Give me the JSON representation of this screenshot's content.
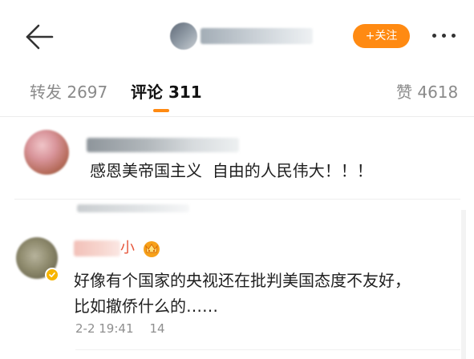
{
  "header": {
    "follow_label": "+关注"
  },
  "tabs": [
    {
      "label": "转发 2697",
      "active": false
    },
    {
      "label": "评论 311",
      "active": true
    },
    {
      "label": "赞 4618",
      "active": false
    }
  ],
  "comments": [
    {
      "text": "感恩美帝国主义  自由的人民伟大！！！"
    },
    {
      "name_visible": "小",
      "text_lines": [
        "好像有个国家的央视还在批判美国态度不友好，",
        "比如撤侨什么的……"
      ],
      "time": "2-2 19:41",
      "likes": "14"
    }
  ],
  "colors": {
    "accent": "#ff8a12",
    "name_red": "#e6553a",
    "verified": "#f7b500",
    "meta_gray": "#8f8f8f"
  },
  "icons": {
    "back": "back-arrow-icon",
    "more": "more-dots-icon",
    "verified": "verified-badge-icon",
    "vip": "vip-crown-icon"
  }
}
